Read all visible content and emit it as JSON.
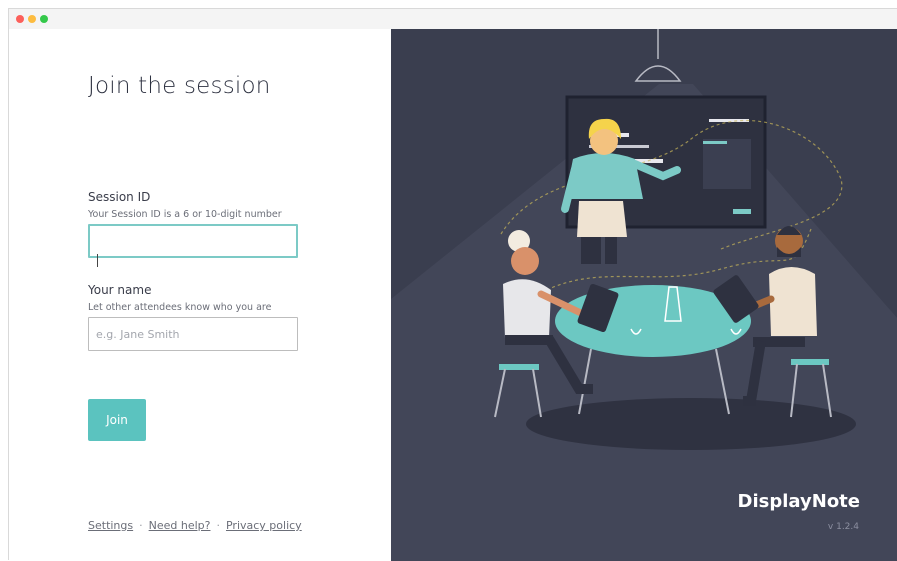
{
  "window": {
    "buttons": [
      "close",
      "minimize",
      "zoom"
    ]
  },
  "form": {
    "title": "Join the session",
    "session_id": {
      "label": "Session ID",
      "hint": "Your Session ID is a 6 or 10-digit number",
      "value": "",
      "placeholder": ""
    },
    "name": {
      "label": "Your name",
      "hint": "Let other attendees know who you are",
      "value": "",
      "placeholder": "e.g. Jane Smith"
    },
    "join_label": "Join"
  },
  "footer": {
    "links": [
      "Settings",
      "Need help?",
      "Privacy policy"
    ],
    "separator": "·"
  },
  "brand": {
    "name": "DisplayNote",
    "version": "v 1.2.4"
  },
  "colors": {
    "accent": "#5bc3bf",
    "panel_bg": "#3a3e4f",
    "title_text": "#2d3140"
  }
}
